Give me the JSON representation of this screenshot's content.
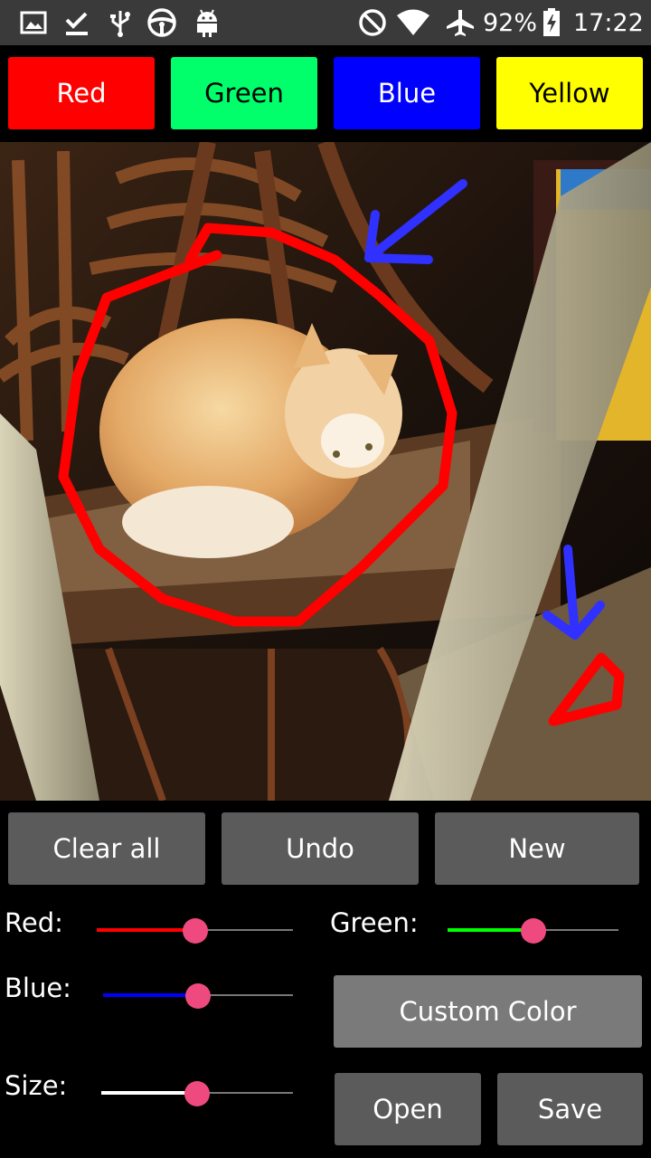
{
  "status_bar": {
    "battery": "92%",
    "time": "17:22",
    "icons": [
      "image-icon",
      "download-done-icon",
      "usb-icon",
      "steering-wheel-icon",
      "android-icon",
      "do-not-disturb-icon",
      "wifi-icon",
      "airplane-mode-icon",
      "battery-charging-icon"
    ]
  },
  "color_buttons": [
    {
      "label": "Red",
      "bg": "#ff0000",
      "fg": "#ffffff"
    },
    {
      "label": "Green",
      "bg": "#00ff6a",
      "fg": "#000000"
    },
    {
      "label": "Blue",
      "bg": "#0000ff",
      "fg": "#ffffff"
    },
    {
      "label": "Yellow",
      "bg": "#ffff00",
      "fg": "#000000"
    }
  ],
  "actions": {
    "clear_all": "Clear all",
    "undo": "Undo",
    "new": "New",
    "custom_color": "Custom Color",
    "open": "Open",
    "save": "Save"
  },
  "sliders": {
    "red": {
      "label": "Red:",
      "value": 0.5,
      "color": "#ff0000"
    },
    "green": {
      "label": "Green:",
      "value": 0.5,
      "color": "#00ff00"
    },
    "blue": {
      "label": "Blue:",
      "value": 0.5,
      "color": "#0000ff"
    },
    "size": {
      "label": "Size:",
      "value": 0.5,
      "color": "#ffffff"
    }
  },
  "colors": {
    "thumb": "#ef4a7f",
    "button_gray": "#5b5b5b",
    "custom_button_gray": "#7a7a7a",
    "status_bar": "#3a3a3a"
  }
}
